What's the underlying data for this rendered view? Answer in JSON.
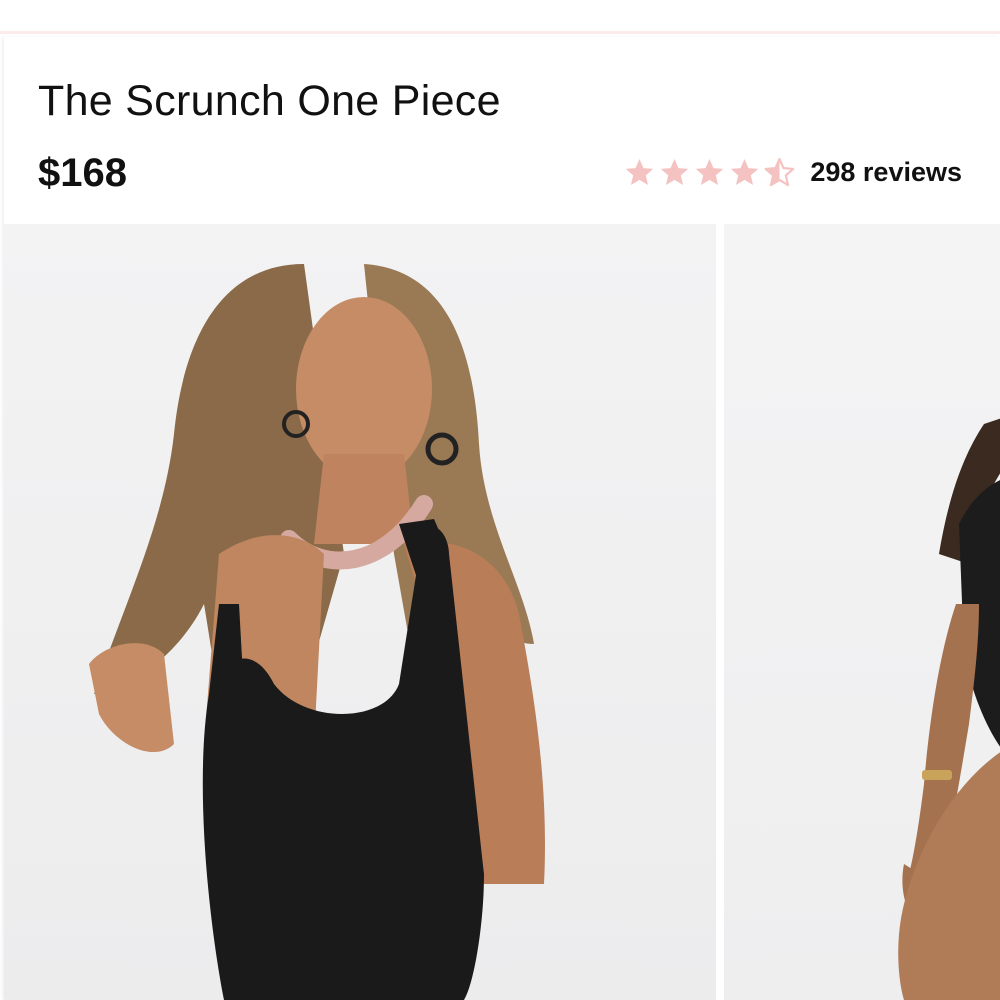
{
  "product": {
    "title": "The Scrunch One Piece",
    "price": "$168",
    "rating": {
      "value": 4.5,
      "max": 5,
      "reviews_label": "298 reviews"
    }
  },
  "gallery": {
    "images": [
      {
        "name": "model wearing black one piece swimsuit, front-side view"
      },
      {
        "name": "model wearing black one piece swimsuit, side view"
      }
    ]
  },
  "colors": {
    "star": "#f4c2c0",
    "text": "#111111",
    "divider": "#fbeaea",
    "photo_background": "#f1f1f2"
  }
}
